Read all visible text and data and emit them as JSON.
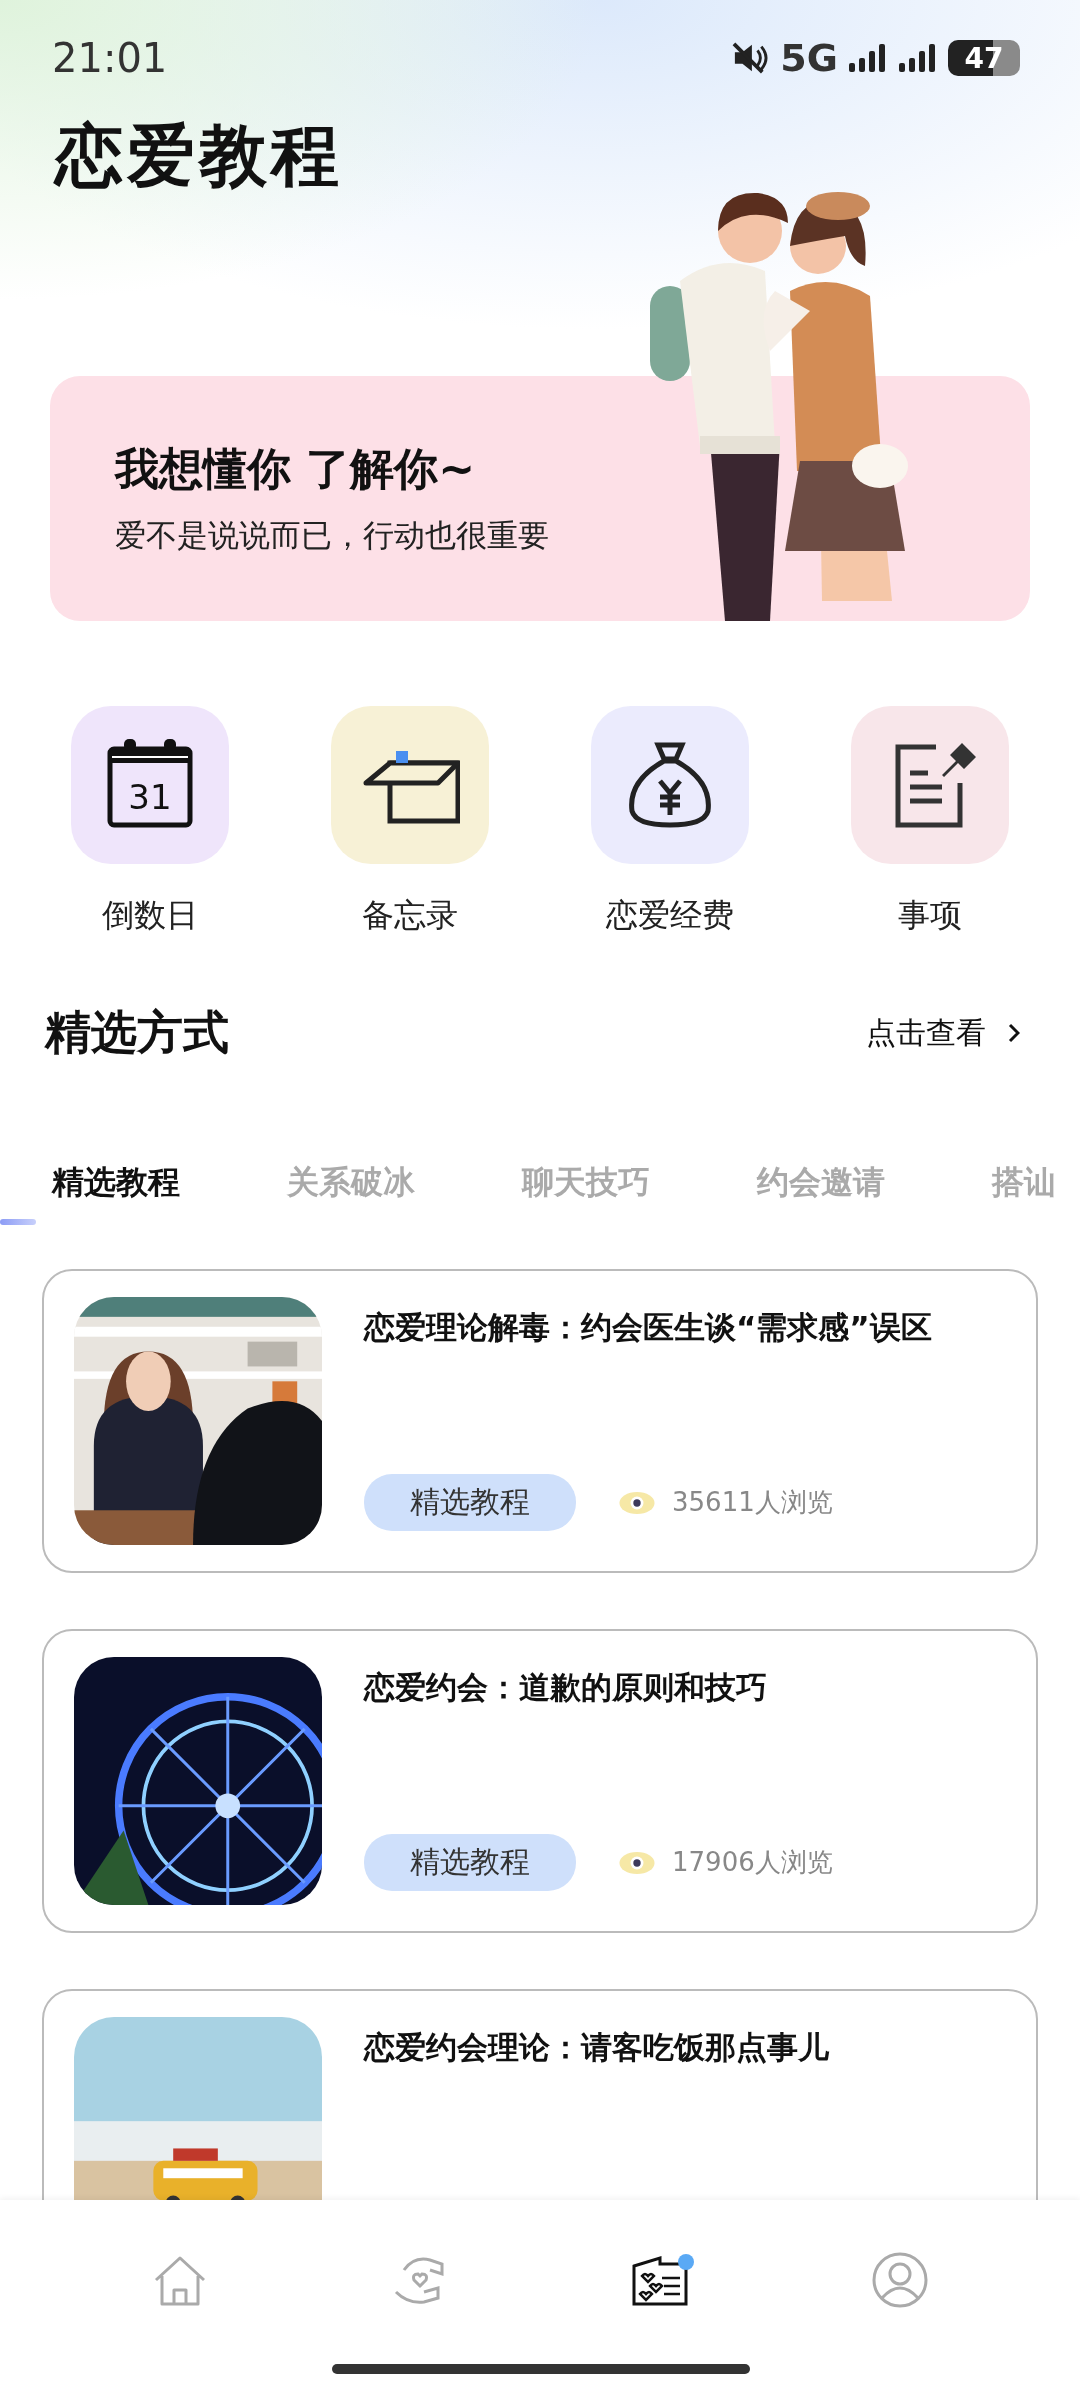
{
  "status_bar": {
    "time": "21:01",
    "network": "5G",
    "battery": "47"
  },
  "title": "恋爱教程",
  "banner": {
    "headline": "我想懂你 了解你~",
    "subtitle": "爱不是说说而已，行动也很重要"
  },
  "shortcuts": [
    {
      "kind": "calendar",
      "label": "倒数日",
      "icon_text": "31",
      "color": "#efe5fb"
    },
    {
      "kind": "box",
      "label": "备忘录",
      "color": "#f7f1d6"
    },
    {
      "kind": "moneybag",
      "label": "恋爱经费",
      "color": "#ebebfd"
    },
    {
      "kind": "note",
      "label": "事项",
      "color": "#f8e6ea"
    }
  ],
  "section": {
    "title": "精选方式",
    "more": "点击查看"
  },
  "tabs": [
    {
      "label": "精选教程",
      "selected": true
    },
    {
      "label": "关系破冰",
      "selected": false
    },
    {
      "label": "聊天技巧",
      "selected": false
    },
    {
      "label": "约会邀请",
      "selected": false
    },
    {
      "label": "搭讪",
      "selected": false
    }
  ],
  "articles": [
    {
      "title": "恋爱理论解毒：约会医生谈“需求感”误区",
      "tag": "精选教程",
      "views": "35611人浏览"
    },
    {
      "title": "恋爱约会：道歉的原则和技巧",
      "tag": "精选教程",
      "views": "17906人浏览"
    },
    {
      "title": "恋爱约会理论：请客吃饭那点事儿"
    }
  ],
  "nav": [
    {
      "kind": "home",
      "selected": false,
      "dot": false
    },
    {
      "kind": "hands",
      "selected": false,
      "dot": false
    },
    {
      "kind": "card",
      "selected": true,
      "dot": true
    },
    {
      "kind": "profile",
      "selected": false,
      "dot": false
    }
  ]
}
